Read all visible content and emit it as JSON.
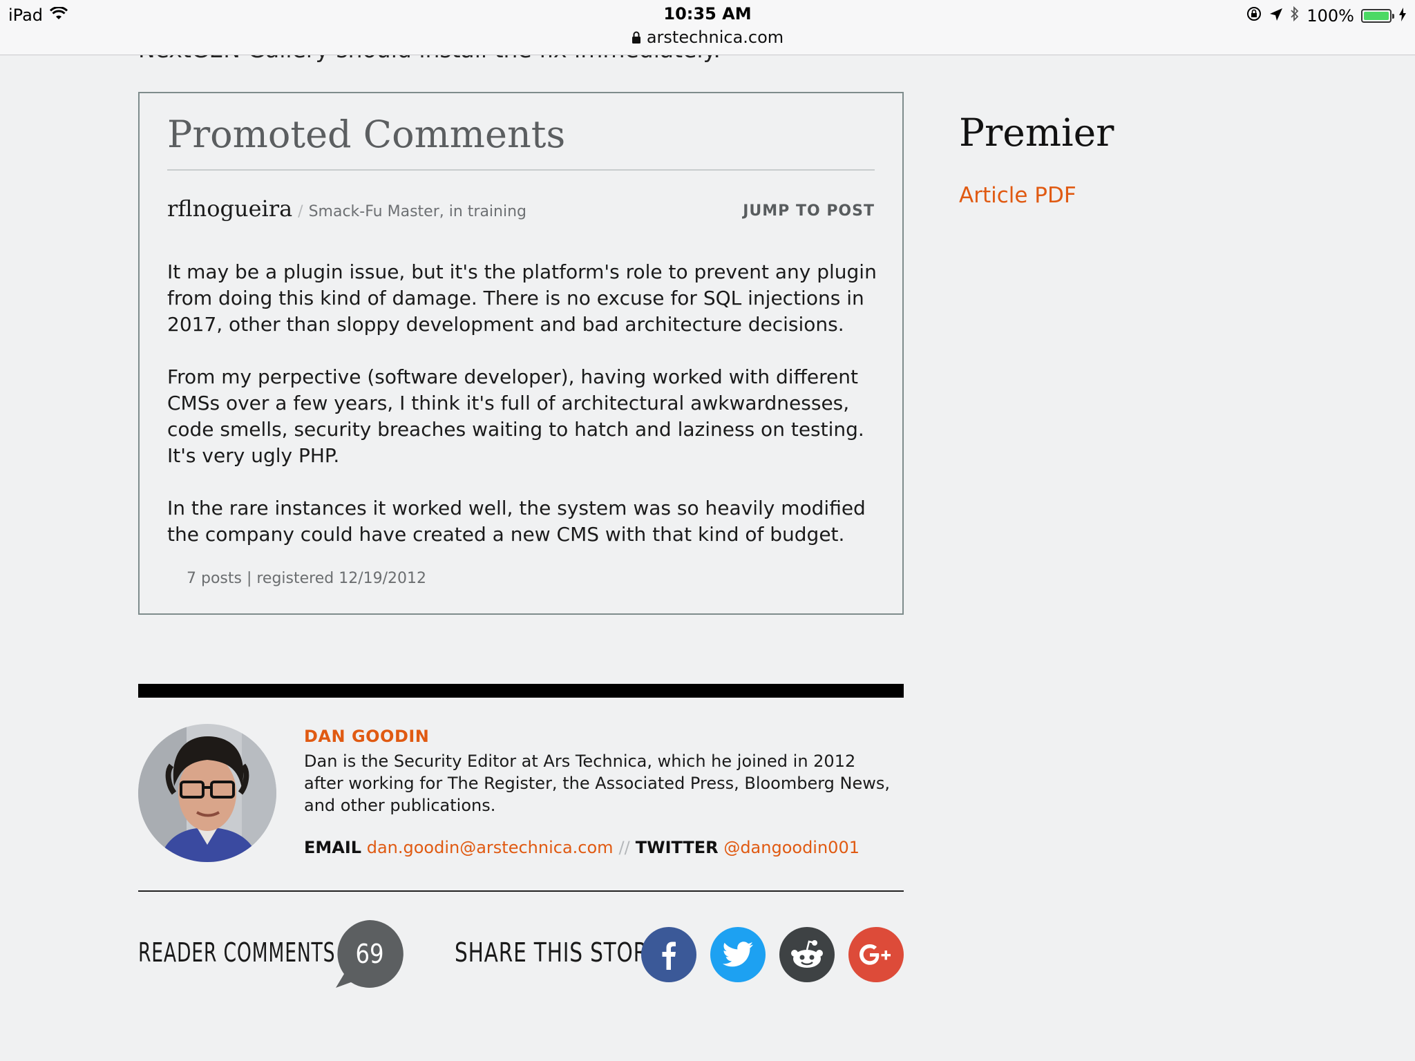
{
  "status_bar": {
    "device": "iPad",
    "time": "10:35 AM",
    "url": "arstechnica.com",
    "battery": "100%"
  },
  "article": {
    "cutoff_text": "NextGEN Gallery should install the fix immediately."
  },
  "promoted": {
    "title": "Promoted Comments",
    "commenter": "rflnogueira",
    "separator": "/",
    "rank": "Smack-Fu Master, in training",
    "jump_label": "JUMP TO POST",
    "paragraphs": [
      "It may be a plugin issue, but it's the platform's role to prevent any plugin from doing this kind of damage. There is no excuse for SQL injections in 2017, other than sloppy development and bad architecture decisions.",
      "From my perpective (software developer), having worked with different CMSs over a few years, I think it's full of architectural awkwardnesses, code smells, security breaches waiting to hatch and laziness on testing. It's very ugly PHP.",
      "In the rare instances it worked well, the system was so heavily modified the company could have created a new CMS with that kind of budget."
    ],
    "meta": "7 posts | registered 12/19/2012"
  },
  "sidebar": {
    "heading": "Premier",
    "link": "Article PDF"
  },
  "author": {
    "name": "DAN GOODIN",
    "bio": "Dan is the Security Editor at Ars Technica, which he joined in 2012 after working for The Register, the Associated Press, Bloomberg News, and other publications.",
    "email_label": "EMAIL",
    "email": "dan.goodin@arstechnica.com",
    "divider": "//",
    "twitter_label": "TWITTER",
    "twitter": "@dangoodin001"
  },
  "footer": {
    "reader_comments_label": "READER COMMENTS",
    "comment_count": "69",
    "share_label": "SHARE THIS STORY"
  },
  "colors": {
    "accent": "#e05a12",
    "facebook": "#3b5998",
    "twitter": "#1da1f2",
    "reddit": "#3e4244",
    "googleplus": "#dd4b39"
  }
}
